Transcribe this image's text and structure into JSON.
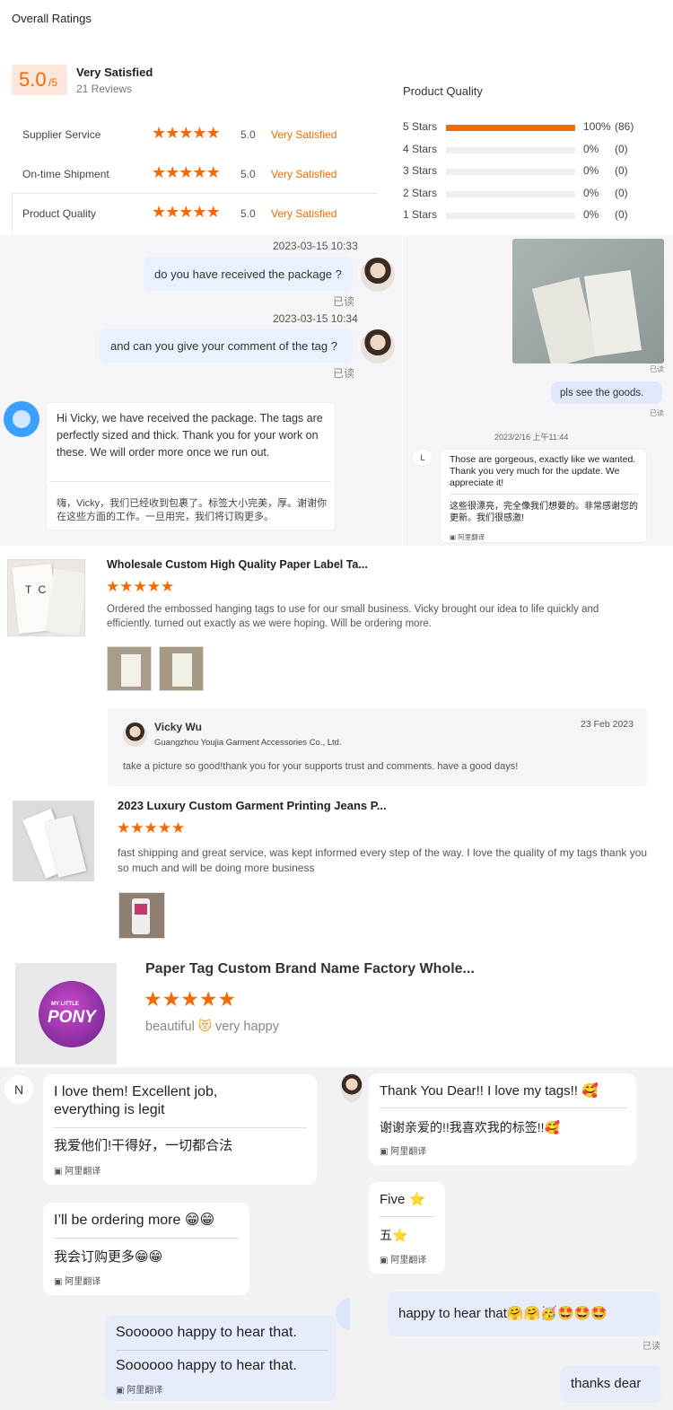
{
  "overall": {
    "heading": "Overall Ratings",
    "score": "5.0",
    "score_suffix": "/5",
    "verdict": "Very Satisfied",
    "reviews_count": "21 Reviews",
    "metrics": [
      {
        "label": "Supplier Service",
        "value": "5.0",
        "verdict": "Very Satisfied",
        "stars": 5
      },
      {
        "label": "On-time Shipment",
        "value": "5.0",
        "verdict": "Very Satisfied",
        "stars": 5
      },
      {
        "label": "Product Quality",
        "value": "5.0",
        "verdict": "Very Satisfied",
        "stars": 5
      }
    ],
    "accent_color": "#f56a00"
  },
  "product_quality": {
    "title": "Product Quality",
    "rows": [
      {
        "label": "5 Stars",
        "percent": "100%",
        "count": "(86)",
        "fill": 1.0
      },
      {
        "label": "4 Stars",
        "percent": "0%",
        "count": "(0)",
        "fill": 0
      },
      {
        "label": "3 Stars",
        "percent": "0%",
        "count": "(0)",
        "fill": 0
      },
      {
        "label": "2 Stars",
        "percent": "0%",
        "count": "(0)",
        "fill": 0
      },
      {
        "label": "1 Stars",
        "percent": "0%",
        "count": "(0)",
        "fill": 0
      }
    ]
  },
  "chat1": {
    "msg1_time": "2023-03-15 10:33",
    "msg1_text": "do you have received the package ?",
    "msg1_status": "已读",
    "msg2_time": "2023-03-15 10:34",
    "msg2_text": "and can you give your comment of the tag ?",
    "msg2_status": "已读",
    "reply_en": "Hi Vicky, we have received the package. The tags are perfectly sized and thick. Thank you for your work on these. We will order more once we run out.",
    "reply_zh": "嗨，Vicky，我们已经收到包裹了。标签大小完美，厚。谢谢你在这些方面的工作。一旦用完，我们将订购更多。"
  },
  "chat2": {
    "image_status": "已读",
    "msg_text": "pls see the goods.",
    "msg_status": "已读",
    "time": "2023/2/16 上午11:44",
    "avatar_letter": "L",
    "reply_en": "Those are gorgeous, exactly like we wanted. Thank you very much for the update. We appreciate it!",
    "reply_zh": "这些很漂亮，完全像我们想要的。非常感谢您的更新。我们很感激!",
    "translate_label": "阿里翻译"
  },
  "review1": {
    "title": "Wholesale Custom High Quality Paper Label Ta...",
    "thumb_text": "T C",
    "text": "Ordered the embossed hanging tags to use for our small business. Vicky brought our idea to life quickly and efficiently. turned out exactly as we were hoping.  Will be ordering more.",
    "reply_name": "Vicky Wu",
    "reply_company": "Guangzhou Youjia Garment Accessories Co., Ltd.",
    "reply_date": "23 Feb 2023",
    "reply_text": "take a picture so good!thank you for your supports trust and comments. have a  good days!"
  },
  "review2": {
    "title": "2023 Luxury Custom Garment Printing Jeans P...",
    "text": "fast shipping and great service, was kept informed every step of the way. I love the quality of my tags thank you so much and will be doing more business"
  },
  "review3": {
    "title": "Paper Tag Custom Brand Name Factory Whole...",
    "logo_top": "MY LITTLE",
    "logo_main": "PONY",
    "text_a": "beautiful",
    "emoji": "😻",
    "text_b": "very happy"
  },
  "chat3": {
    "avatar_letter": "N",
    "m1_en": "I love them! Excellent job, everything is legit",
    "m1_zh": "我爱他们!干得好，一切都合法",
    "m2_en": "I’ll be ordering more 😁😁",
    "m2_zh": "我会订购更多😁😁",
    "m3_a": "Soooooo happy to hear that.",
    "m3_b": "Soooooo happy to hear that.",
    "translate_label": "阿里翻译"
  },
  "chat4": {
    "m1_en": "Thank You Dear!! I love my tags!! 🥰",
    "m1_zh": "谢谢亲爱的!!我喜欢我的标签!!🥰",
    "m2_en": "Five ⭐",
    "m2_zh": "五⭐",
    "m3": "happy to hear that🤗🤗🥳🤩🤩🤩",
    "m3_status": "已读",
    "m4": "thanks dear",
    "translate_label": "阿里翻译"
  }
}
